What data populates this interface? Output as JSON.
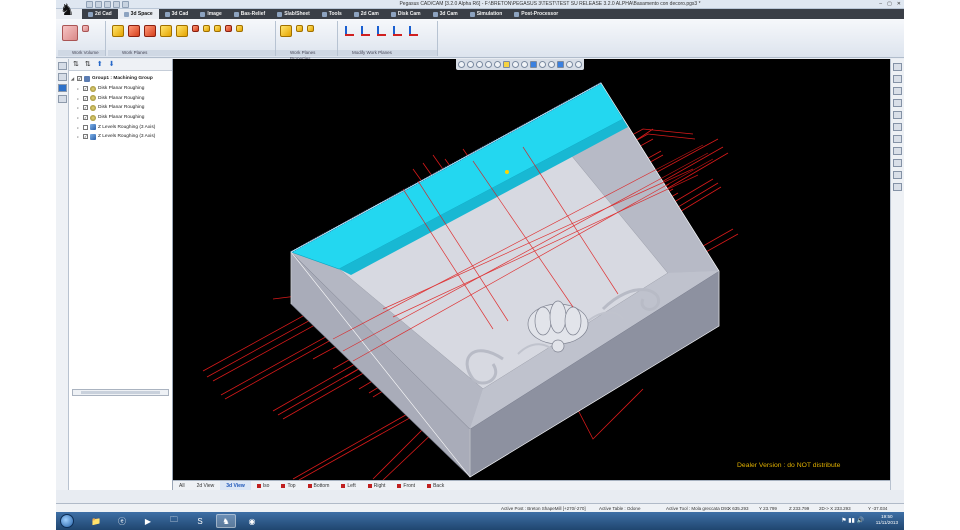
{
  "window": {
    "title": "Pegasus CAD/CAM [3.2.0 Alpha R6] - F:\\BRETON\\PEGASUS 3\\TEST\\TEST SU RELEASE 3.2.0 ALPHA\\Basamento con decoro.pgs3 *",
    "minimize": "–",
    "maximize": "▢",
    "close": "✕"
  },
  "menu": {
    "tabs": [
      {
        "label": "2d Cad",
        "active": false
      },
      {
        "label": "3d Space",
        "active": true
      },
      {
        "label": "3d Cad",
        "active": false
      },
      {
        "label": "Image",
        "active": false
      },
      {
        "label": "Bas-Relief",
        "active": false
      },
      {
        "label": "Slab/Sheet",
        "active": false
      },
      {
        "label": "Tools",
        "active": false
      },
      {
        "label": "2d Cam",
        "active": false
      },
      {
        "label": "Disk Cam",
        "active": false
      },
      {
        "label": "3d Cam",
        "active": false
      },
      {
        "label": "Simulation",
        "active": false
      },
      {
        "label": "Post-Processor",
        "active": false
      }
    ]
  },
  "ribbon": {
    "groups": [
      "Work Volume",
      "Work Planes",
      "Work Planes Properties",
      "Modify Work Planes"
    ]
  },
  "tree": {
    "rows": [
      {
        "label": "Group1 : Machining Group",
        "kind": "group",
        "checked": true
      },
      {
        "label": "Disk Planar Roughing",
        "kind": "op",
        "checked": true
      },
      {
        "label": "Disk Planar Roughing",
        "kind": "op",
        "checked": true
      },
      {
        "label": "Disk Planar Roughing",
        "kind": "op",
        "checked": true
      },
      {
        "label": "Disk Planar Roughing",
        "kind": "op",
        "checked": true
      },
      {
        "label": "Z Levels Roughing (3 Axis)",
        "kind": "z",
        "checked": false
      },
      {
        "label": "Z Levels Roughing (3 Axis)",
        "kind": "z",
        "checked": true
      }
    ]
  },
  "viewport": {
    "watermark": "Dealer Version : do NOT distribute"
  },
  "view_tabs": [
    {
      "label": "All",
      "active": false
    },
    {
      "label": "2d View",
      "active": false
    },
    {
      "label": "3d View",
      "active": true
    },
    {
      "label": "Iso",
      "active": false
    },
    {
      "label": "Top",
      "active": false
    },
    {
      "label": "Bottom",
      "active": false
    },
    {
      "label": "Left",
      "active": false
    },
    {
      "label": "Right",
      "active": false
    },
    {
      "label": "Front",
      "active": false
    },
    {
      "label": "Back",
      "active": false
    }
  ],
  "status": {
    "active_post": "Active Post : Breton ShapeMill [+270/-270]",
    "active_table": "Active Table : Odone",
    "active_tool": "Active Tool : Mola greccata D91",
    "x": "X 635.293",
    "y": "Y 23.799",
    "z": "Z 233.799",
    "zd": "2D-> X 233.293",
    "yd": "Y -37.034"
  },
  "taskbar": {
    "time": "19:50",
    "date": "11/11/2013"
  },
  "colors": {
    "viewport_bg": "#000000",
    "watermark": "#e0b000",
    "toolpath": "#d81a1a",
    "stock_top": "#23d7f0",
    "part": "#b9bcc8"
  }
}
